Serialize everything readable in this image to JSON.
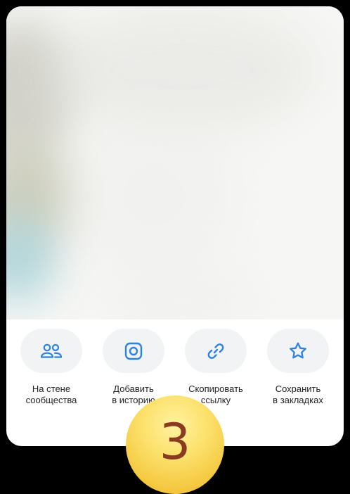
{
  "share_sheet": {
    "actions": [
      {
        "icon": "community-wall-icon",
        "line1": "На стене",
        "line2": "сообщества"
      },
      {
        "icon": "story-icon",
        "line1": "Добавить",
        "line2": "в историю"
      },
      {
        "icon": "link-icon",
        "line1": "Скопировать",
        "line2": "ссылку"
      },
      {
        "icon": "star-icon",
        "line1": "Сохранить",
        "line2": "в закладках"
      }
    ]
  },
  "step_badge": {
    "number": "3"
  },
  "colors": {
    "accent": "#2d81e0",
    "button_bg": "#f2f3f5",
    "badge_text": "#8b3a22"
  }
}
